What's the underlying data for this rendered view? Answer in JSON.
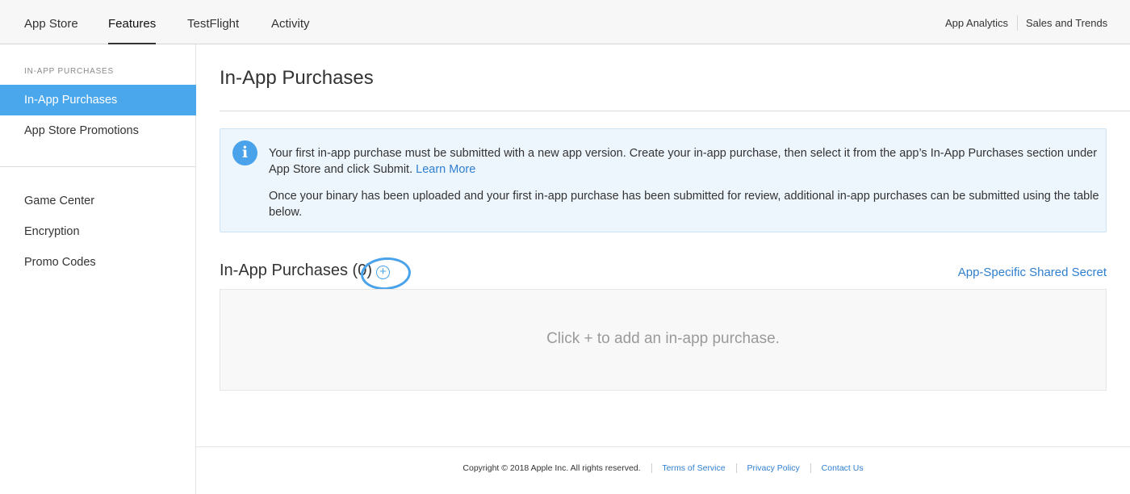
{
  "topnav": {
    "tabs": [
      {
        "label": "App Store"
      },
      {
        "label": "Features"
      },
      {
        "label": "TestFlight"
      },
      {
        "label": "Activity"
      }
    ],
    "active_tab": "Features",
    "right_links": [
      {
        "label": "App Analytics"
      },
      {
        "label": "Sales and Trends"
      }
    ]
  },
  "sidebar": {
    "section_label": "IN-APP PURCHASES",
    "items": [
      {
        "label": "In-App Purchases"
      },
      {
        "label": "App Store Promotions"
      },
      {
        "label": "Game Center"
      },
      {
        "label": "Encryption"
      },
      {
        "label": "Promo Codes"
      }
    ],
    "active_item": "In-App Purchases"
  },
  "main": {
    "page_title": "In-App Purchases",
    "info": {
      "icon": "info-icon",
      "paragraph1": "Your first in-app purchase must be submitted with a new app version. Create your in-app purchase, then select it from the app’s In-App Purchases section under App Store and click Submit.",
      "learn_more": "Learn More",
      "paragraph2": "Once your binary has been uploaded and your first in-app purchase has been submitted for review, additional in-app purchases can be submitted using the table below."
    },
    "section_heading": "In-App Purchases (0)",
    "add_button_symbol": "+",
    "shared_secret_link": "App-Specific Shared Secret",
    "empty_message": "Click + to add an in-app purchase."
  },
  "footer": {
    "copyright": "Copyright © 2018 Apple Inc. All rights reserved.",
    "links": [
      {
        "label": "Terms of Service"
      },
      {
        "label": "Privacy Policy"
      },
      {
        "label": "Contact Us"
      }
    ]
  },
  "colors": {
    "accent": "#4aa7ec",
    "link": "#2f7fd0",
    "info_bg": "#eef6fd"
  }
}
